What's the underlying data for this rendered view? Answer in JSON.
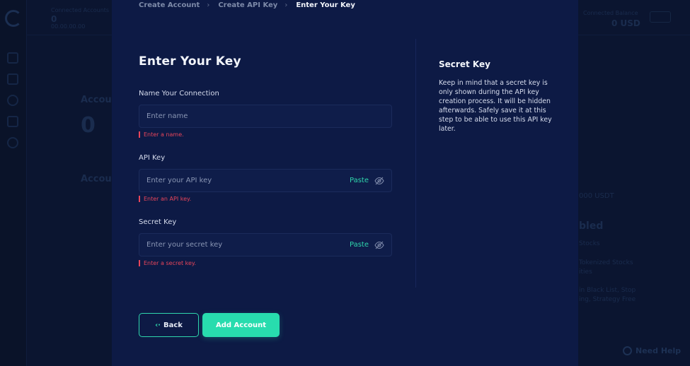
{
  "background": {
    "top_left_label": "Connected Accounts",
    "top_left_value": "0",
    "top_left_sub": "00.00.00.00",
    "top_right_label": "Connected Balance",
    "top_right_value": "0 USD",
    "section_title": "Accou",
    "big_value": "0",
    "section_title_2": "Accou",
    "usdt_text": "000 USDT",
    "panel_title": "bled",
    "line_1": "Stocks",
    "line_2": "Tokenized Stocks",
    "line_3": "ities",
    "line_4": "in Black List, Stop",
    "line_5": "ing, Strategy Free",
    "help_label": "Need Help"
  },
  "stepper": {
    "steps": [
      "Create Account",
      "Create API Key",
      "Enter Your Key"
    ],
    "active_index": 2,
    "separator": "›"
  },
  "form": {
    "title": "Enter Your Key",
    "name": {
      "label": "Name Your Connection",
      "placeholder": "Enter name",
      "value": "",
      "error": "Enter a name."
    },
    "api_key": {
      "label": "API Key",
      "placeholder": "Enter your API key",
      "value": "",
      "paste_label": "Paste",
      "error": "Enter an API key."
    },
    "secret_key": {
      "label": "Secret Key",
      "placeholder": "Enter your secret key",
      "value": "",
      "paste_label": "Paste",
      "error": "Enter a secret key."
    },
    "back_label": "Back",
    "submit_label": "Add Account"
  },
  "info": {
    "title": "Secret Key",
    "text": "Keep in mind that a secret key is only shown during the API key creation process. It will be hidden afterwards. Safely save it at this step to be able to use this API key later."
  },
  "colors": {
    "accent": "#28dcae",
    "error": "#e8455a",
    "modal_bg": "#0d1a45",
    "page_bg": "#0b1530"
  },
  "icons": {
    "eye_toggle": "eye-slash-icon",
    "back_arrow": "arrow-left-icon",
    "help": "chat-bubble-icon"
  }
}
